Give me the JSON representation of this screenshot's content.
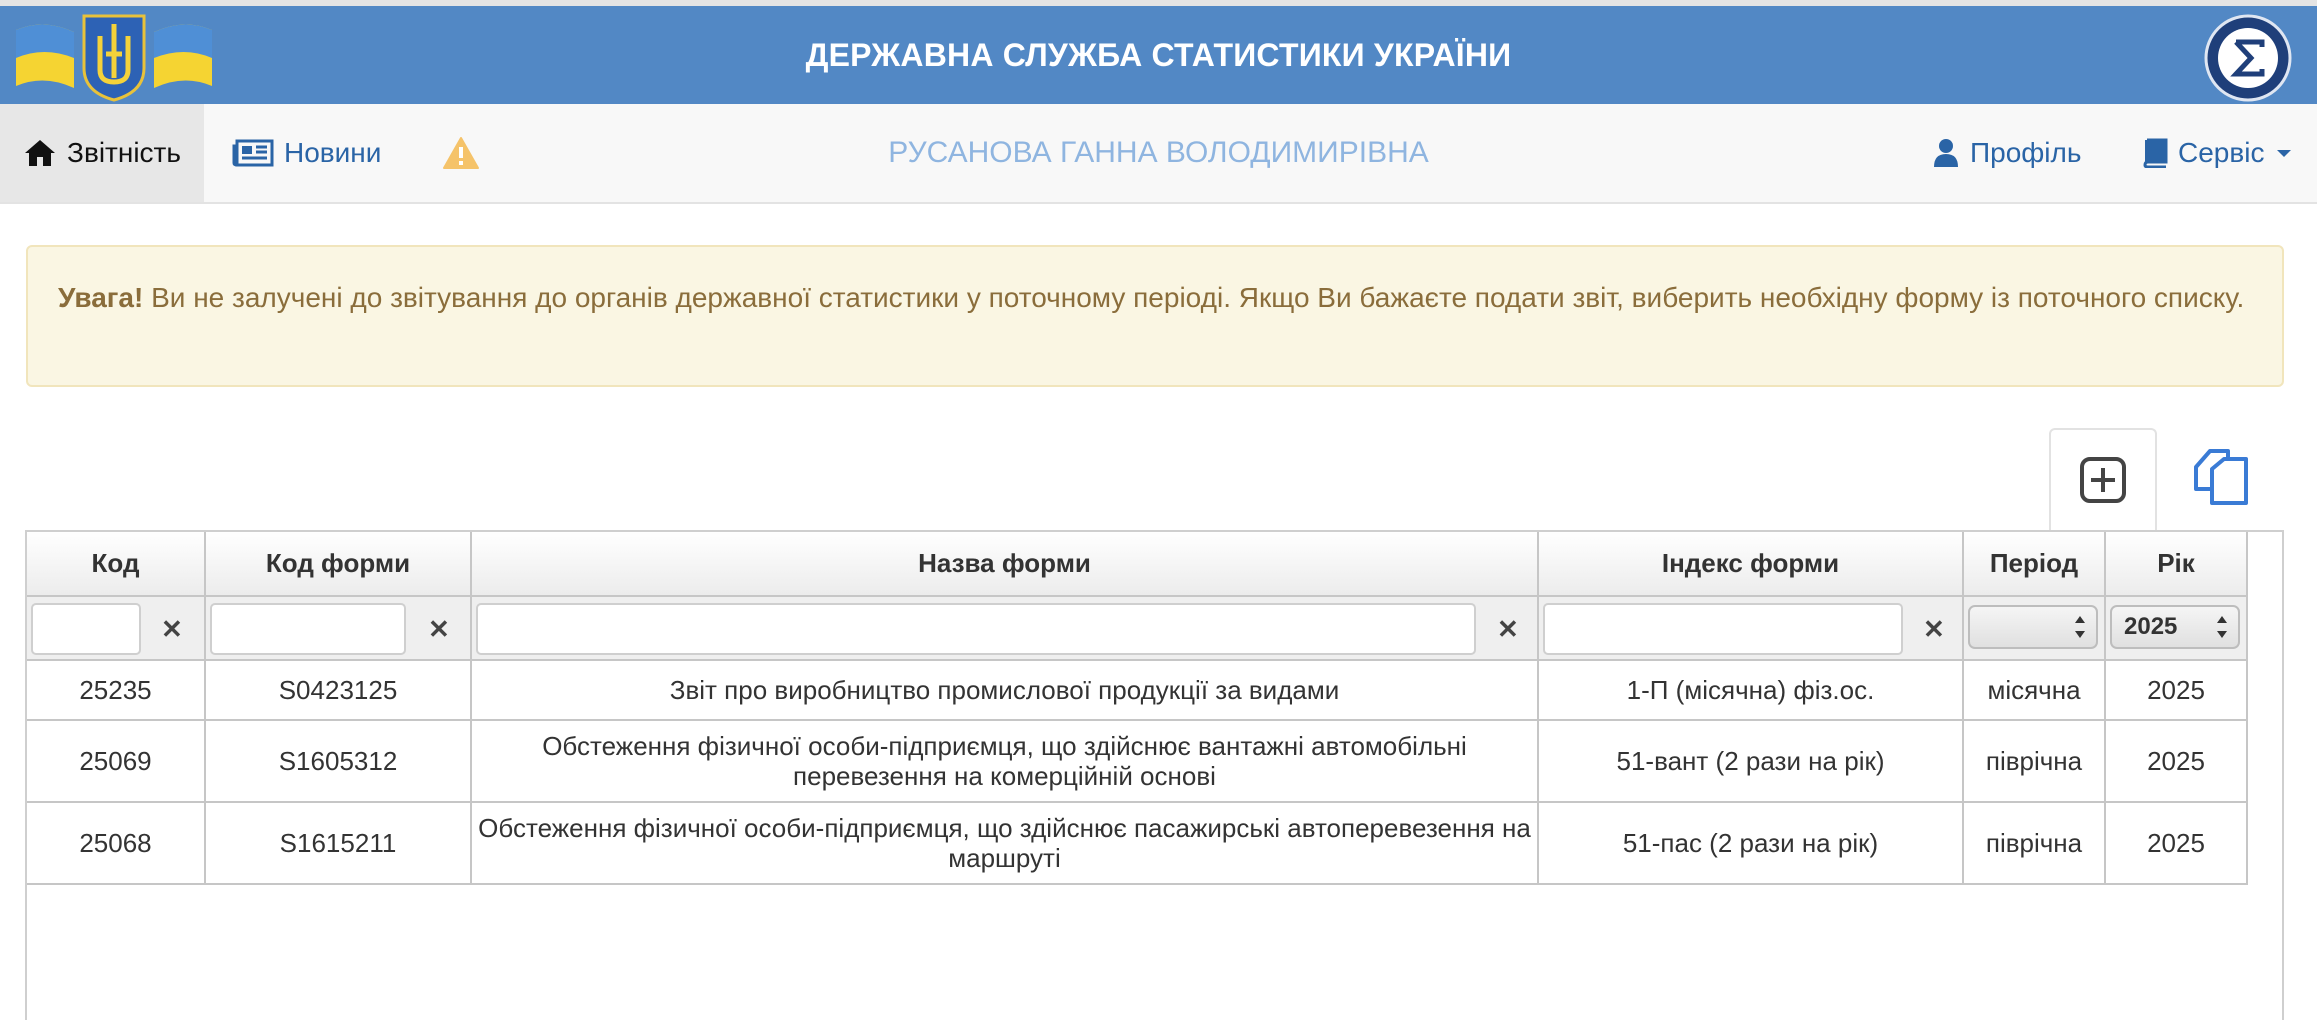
{
  "header": {
    "title": "ДЕРЖАВНА СЛУЖБА СТАТИСТИКИ УКРАЇНИ",
    "accent_color": "#5288c5"
  },
  "nav": {
    "reports_label": "Звітність",
    "news_label": "Новини",
    "user_name": "РУСАНОВА ГАННА ВОЛОДИМИРІВНА",
    "profile_label": "Профіль",
    "service_label": "Сервіс"
  },
  "alert": {
    "strong": "Увага!",
    "text": " Ви не залучені до звітування до органів державної статистики у поточному періоді. Якщо Ви бажаєте подати звіт, виберить необхідну форму із поточного списку."
  },
  "table": {
    "columns": [
      "Код",
      "Код форми",
      "Назва форми",
      "Індекс форми",
      "Період",
      "Рік"
    ],
    "filter": {
      "clear_symbol": "✕",
      "period_selected": "",
      "year_selected": "2025"
    },
    "rows": [
      {
        "code": "25235",
        "form_code": "S0423125",
        "name": "Звіт про виробництво промислової продукції за видами",
        "index": "1-П (місячна) фіз.ос.",
        "period": "місячна",
        "year": "2025"
      },
      {
        "code": "25069",
        "form_code": "S1605312",
        "name": "Обстеження фізичної особи-підприємця, що здійснює вантажні автомобільні перевезення на комерційній основі",
        "index": "51-вант (2 рази на рік)",
        "period": "піврічна",
        "year": "2025"
      },
      {
        "code": "25068",
        "form_code": "S1615211",
        "name": "Обстеження фізичної особи-підприємця, що здійснює пасажирські автоперевезення на маршруті",
        "index": "51-пас (2 рази на рік)",
        "period": "піврічна",
        "year": "2025"
      }
    ]
  },
  "icons": {
    "home": "home-icon",
    "news": "newspaper-icon",
    "warning": "warning-icon",
    "user": "user-icon",
    "book": "book-icon",
    "add": "plus-square-icon",
    "copy": "copy-icon"
  }
}
